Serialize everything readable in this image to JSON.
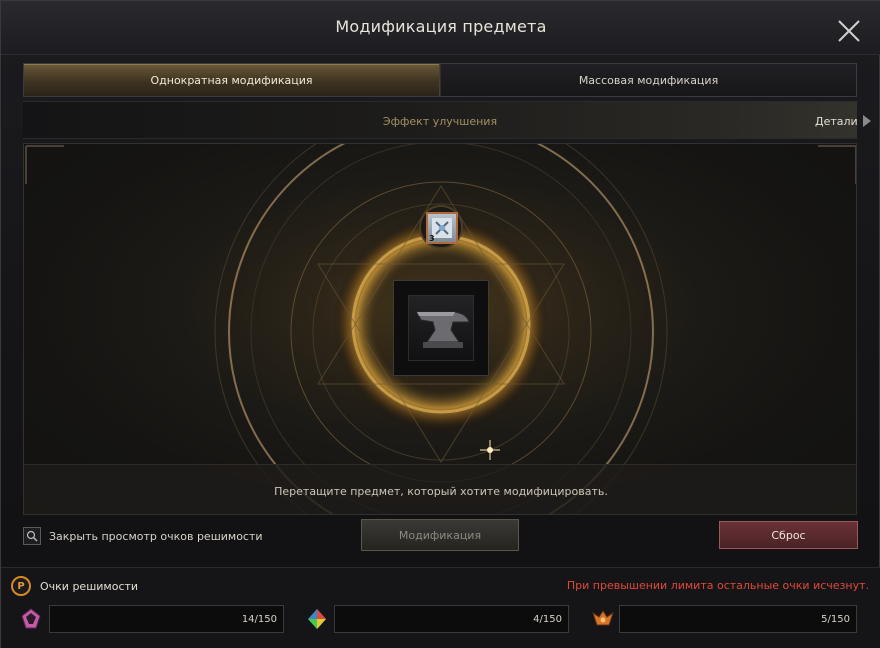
{
  "window": {
    "title": "Модификация предмета"
  },
  "tabs": [
    {
      "label": "Однократная модификация",
      "active": true
    },
    {
      "label": "Массовая модификация",
      "active": false
    }
  ],
  "effect_bar": {
    "label": "Эффект улучшения",
    "details_label": "Детали"
  },
  "stage": {
    "scroll_item": {
      "icon": "scroll-icon",
      "count": "3"
    },
    "item_slot": {
      "icon": "anvil-icon"
    },
    "hint": "Перетащите предмет, который хотите модифицировать."
  },
  "controls": {
    "toggle_label": "Закрыть просмотр очков решимости",
    "modify_label": "Модификация",
    "reset_label": "Сброс"
  },
  "points": {
    "badge": "P",
    "title": "Очки решимости",
    "warning": "При превышении лимита остальные очки исчезнут.",
    "items": [
      {
        "icon": "pink-gem-icon",
        "value": "14/150"
      },
      {
        "icon": "rainbow-gem-icon",
        "value": "4/150"
      },
      {
        "icon": "orange-crest-icon",
        "value": "5/150"
      }
    ]
  },
  "colors": {
    "accent_gold": "#b8892e",
    "warning_red": "#e0493a",
    "reset_button": "#5a2a2e",
    "badge_orange": "#d88a1f"
  }
}
